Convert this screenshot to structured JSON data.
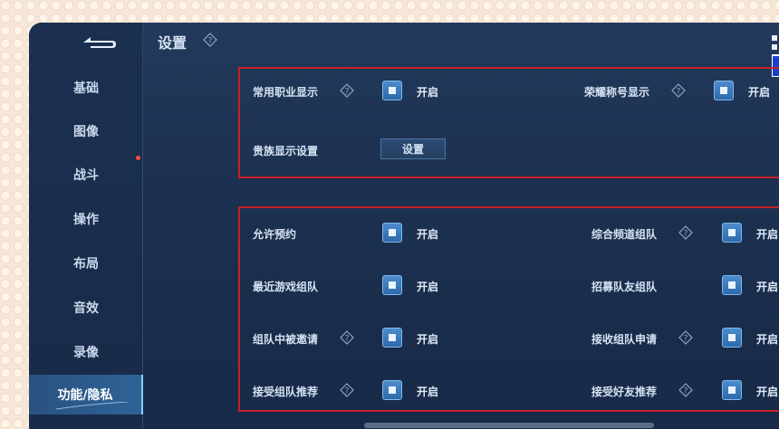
{
  "header": {
    "title": "设置"
  },
  "sidebar": {
    "items": [
      {
        "label": "基础"
      },
      {
        "label": "图像"
      },
      {
        "label": "战斗"
      },
      {
        "label": "操作"
      },
      {
        "label": "布局"
      },
      {
        "label": "音效"
      },
      {
        "label": "录像"
      },
      {
        "label": "功能/隐私"
      }
    ],
    "active_index": 7
  },
  "panel_a": {
    "common_job": {
      "label": "常用职业显示",
      "state": "开启"
    },
    "honor_title": {
      "label": "荣耀称号显示",
      "state": "开启"
    },
    "noble": {
      "label": "贵族显示设置",
      "button": "设置"
    }
  },
  "panel_b": {
    "allow_reservation": {
      "label": "允许预约",
      "state": "开启"
    },
    "channel_team": {
      "label": "综合频道组队",
      "state": "开启"
    },
    "recent_game_team": {
      "label": "最近游戏组队",
      "state": "开启"
    },
    "recruit": {
      "label": "招募队友组队",
      "state": "开启"
    },
    "team_invited": {
      "label": "组队中被邀请",
      "state": "开启"
    },
    "accept_team_request": {
      "label": "接收组队申请",
      "state": "开启"
    },
    "accept_team_recommend": {
      "label": "接受组队推荐",
      "state": "开启"
    },
    "accept_friend_recommend": {
      "label": "接受好友推荐",
      "state": "开启"
    }
  },
  "colors": {
    "accent": "#3a7bc0",
    "highlight_border": "#c8202a",
    "background": "#1c3050"
  },
  "icons": [
    "back-arrow-icon",
    "help-diamond-icon",
    "checkbox-checked-icon",
    "notification-dot-icon"
  ]
}
